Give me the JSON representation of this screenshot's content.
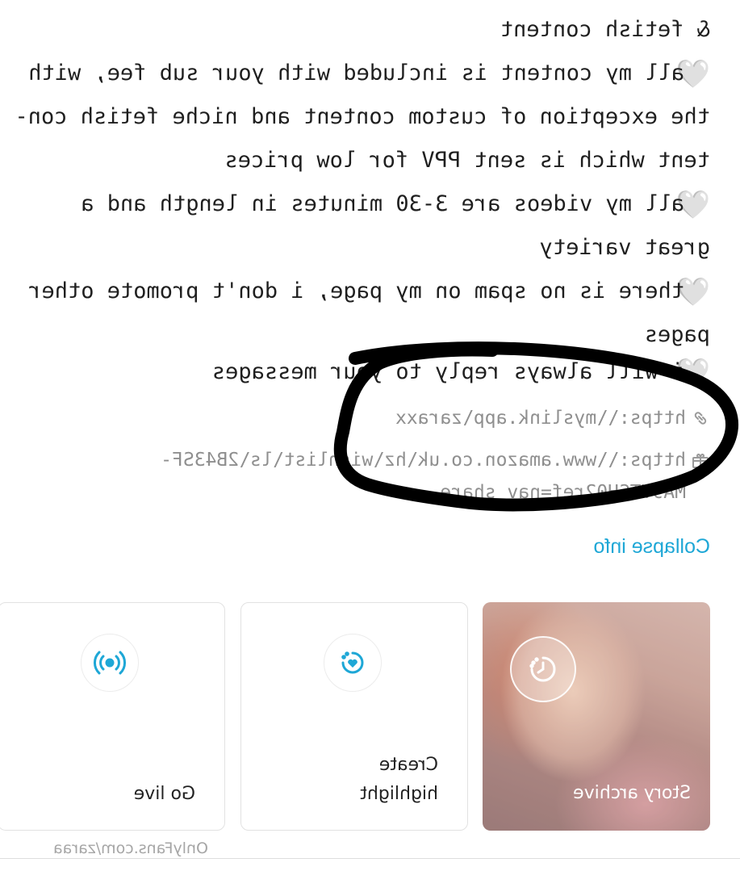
{
  "bio": {
    "lines": [
      "& fetish content",
      "all my content is included with your sub fee, with",
      "the exception of custom content and niche fetish con-",
      "tent which is sent PPV for low prices",
      "all my videos are 3-30 minutes in length and a",
      "great variety",
      "there is no spam on my page, i don't promote other",
      "pages",
      "i will always reply to your messages"
    ],
    "heart_glyph": "🤍"
  },
  "links": [
    {
      "icon": "link-icon",
      "url": "https:\\\\myslink.app\\zaraxx"
    },
    {
      "icon": "gift-icon",
      "url": "https:\\\\www.amazon.co.uk\\hz\\wishlist\\ls\\2B43SF-",
      "url_cont": "MA9YTSH02ref=nav_share"
    }
  ],
  "collapse_label": "Collapse info",
  "cards": [
    {
      "label": "Story archive",
      "icon": "clock-icon"
    },
    {
      "label_line1": "Create",
      "label_line2": "highlight",
      "icon": "highlight-heart-icon"
    },
    {
      "label": "Go live",
      "icon": "broadcast-icon"
    }
  ],
  "footer": {
    "watermark": "OnlyFans.com/zaraa"
  },
  "colors": {
    "accent": "#1ea7d6",
    "text": "#1f1f1f",
    "muted": "#8f8f8f",
    "annotation": "#000000"
  }
}
